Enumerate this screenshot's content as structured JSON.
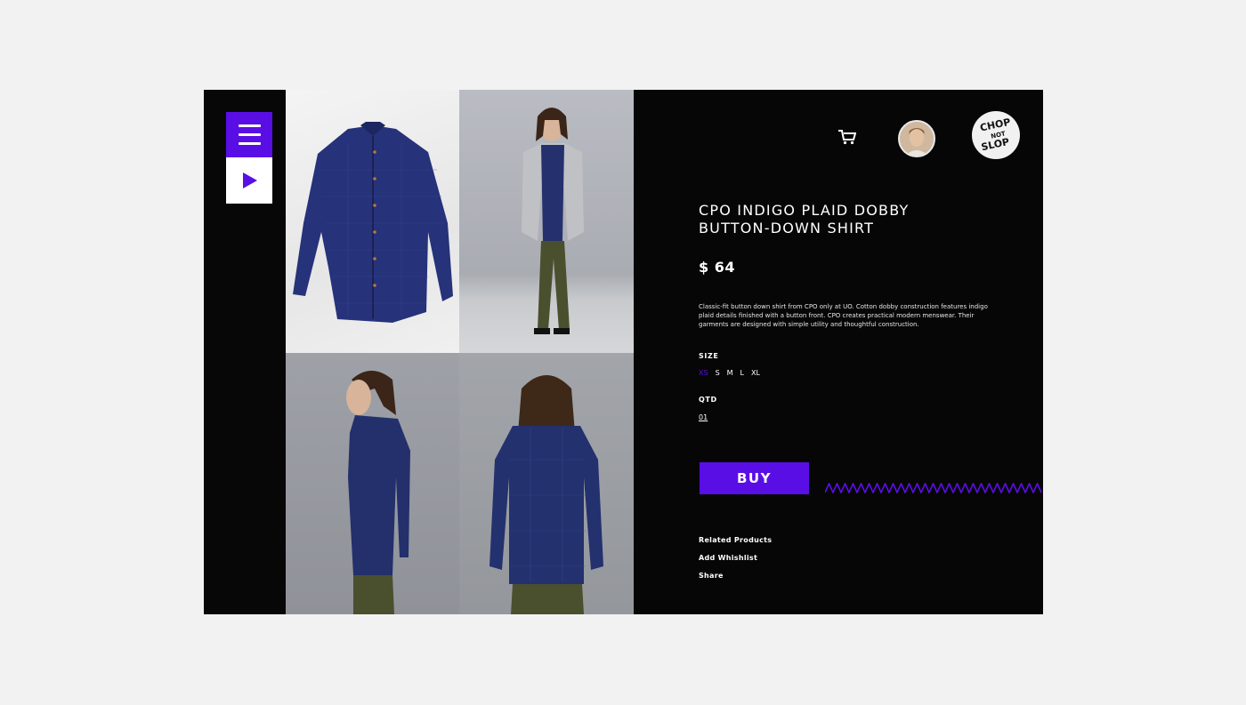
{
  "product": {
    "title": "CPO INDIGO PLAID DOBBY BUTTON-DOWN SHIRT",
    "price": "$ 64",
    "description": "Classic-fit button down shirt from CPO only at UO. Cotton dobby construction features indigo plaid details finished with a button front. CPO creates practical modern menswear. Their garments are designed with simple utility and thoughtful construction."
  },
  "size": {
    "label": "SIZE",
    "options": [
      "XS",
      "S",
      "M",
      "L",
      "XL"
    ],
    "selected": "XS"
  },
  "quantity": {
    "label": "QTD",
    "value": "01"
  },
  "buy_label": "BUY",
  "links": [
    "Related Products",
    "Add Whishlist",
    "Share"
  ],
  "brand": {
    "logo_text": [
      "CHOP",
      "NOT",
      "SLOP"
    ]
  },
  "icons": {
    "menu": "hamburger-menu-icon",
    "play": "play-icon",
    "cart": "cart-icon"
  },
  "colors": {
    "accent": "#5a0ee6",
    "background": "#060606",
    "page": "#f2f2f2"
  }
}
